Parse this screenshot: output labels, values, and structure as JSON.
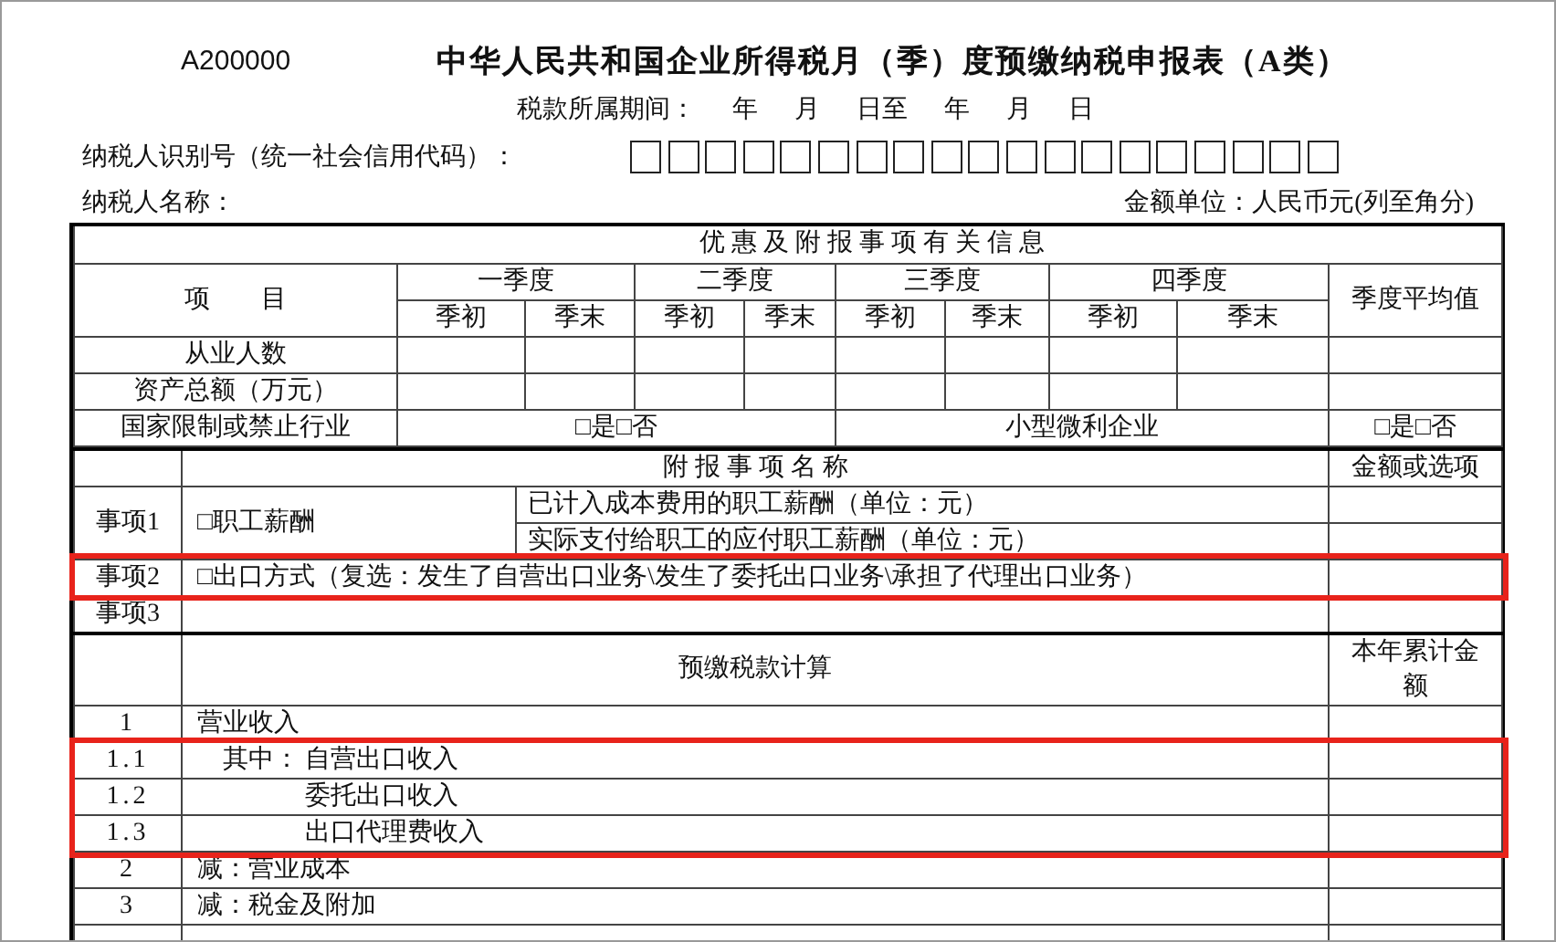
{
  "form_code": "A200000",
  "title": "中华人民共和国企业所得税月（季）度预缴纳税申报表（A类）",
  "period": {
    "label": "税款所属期间：",
    "parts": [
      "年",
      "月",
      "日至",
      "年",
      "月",
      "日"
    ]
  },
  "taxpayer_id": {
    "label": "纳税人识别号（统一社会信用代码）："
  },
  "taxpayer_name": {
    "label": "纳税人名称："
  },
  "currency_unit": "金额单位：人民币元(列至角分)",
  "preferential_info": {
    "heading": "优 惠 及 附 报 事 项 有 关 信 息",
    "item_header": "项　　目",
    "average_header": "季度平均值",
    "quarters": [
      {
        "label": "一季度",
        "start": "季初",
        "end": "季末"
      },
      {
        "label": "二季度",
        "start": "季初",
        "end": "季末"
      },
      {
        "label": "三季度",
        "start": "季初",
        "end": "季末"
      },
      {
        "label": "四季度",
        "start": "季初",
        "end": "季末"
      }
    ],
    "rows": [
      {
        "label": "从业人数"
      },
      {
        "label": "资产总额（万元）"
      }
    ],
    "restricted_industry": {
      "label": "国家限制或禁止行业",
      "value": "□是□否"
    },
    "small_enterprise": {
      "label": "小型微利企业",
      "value": "□是□否"
    }
  },
  "appended_items": {
    "heading": "附 报 事 项 名 称",
    "value_header": "金额或选项",
    "items": [
      {
        "number": "事项1",
        "name": "□职工薪酬",
        "sub_items": [
          "已计入成本费用的职工薪酬（单位：元）",
          "实际支付给职工的应付职工薪酬（单位：元）"
        ],
        "highlighted": false
      },
      {
        "number": "事项2",
        "name": "□出口方式（复选：发生了自营出口业务\\发生了委托出口业务\\承担了代理出口业务）",
        "highlighted": true
      },
      {
        "number": "事项3",
        "highlighted": false
      }
    ]
  },
  "calculation": {
    "heading": "预缴税款计算",
    "amount_header": "本年累计金额",
    "rows": [
      {
        "line": "1",
        "label": "营业收入",
        "highlighted": false,
        "children": [
          {
            "line": "1.1",
            "prefix": "其中：",
            "label": "自营出口收入",
            "highlighted": true
          },
          {
            "line": "1.2",
            "label": "委托出口收入",
            "highlighted": true
          },
          {
            "line": "1.3",
            "label": "出口代理费收入",
            "highlighted": true
          }
        ]
      },
      {
        "line": "2",
        "label": "减：营业成本",
        "highlighted": false
      },
      {
        "line": "3",
        "label": "减：税金及附加",
        "highlighted": false
      }
    ]
  }
}
